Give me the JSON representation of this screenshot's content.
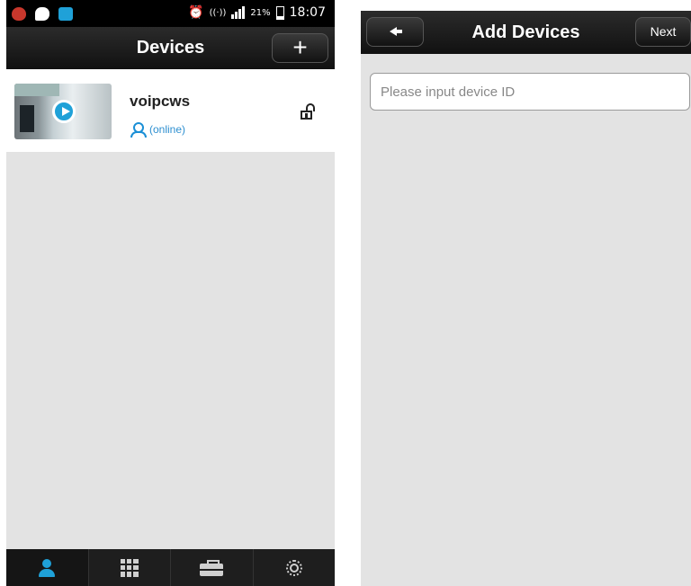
{
  "status_bar": {
    "battery_percent": "21%",
    "time": "18:07",
    "left_icons": [
      "antivirus-icon",
      "chat-icon",
      "app-icon"
    ],
    "right_icons": [
      "alarm-icon",
      "wifi-icon",
      "signal-icon",
      "battery-icon"
    ]
  },
  "devices_screen": {
    "title": "Devices",
    "add_button_label": "+",
    "devices": [
      {
        "name": "voipcws",
        "status": "(online)",
        "lock_icon": "unlock-icon"
      }
    ],
    "tabs": [
      {
        "icon": "contacts-icon",
        "active": true
      },
      {
        "icon": "grid-icon",
        "active": false
      },
      {
        "icon": "toolbox-icon",
        "active": false
      },
      {
        "icon": "settings-gear-icon",
        "active": false
      }
    ]
  },
  "add_devices_screen": {
    "title": "Add Devices",
    "back_icon": "back-arrow-icon",
    "next_label": "Next",
    "device_id_input": {
      "value": "",
      "placeholder": "Please input device ID"
    }
  },
  "colors": {
    "accent": "#1fa1d8",
    "status_online": "#2d8fd0",
    "bar_dark": "#111111",
    "content_bg": "#e3e3e3"
  }
}
